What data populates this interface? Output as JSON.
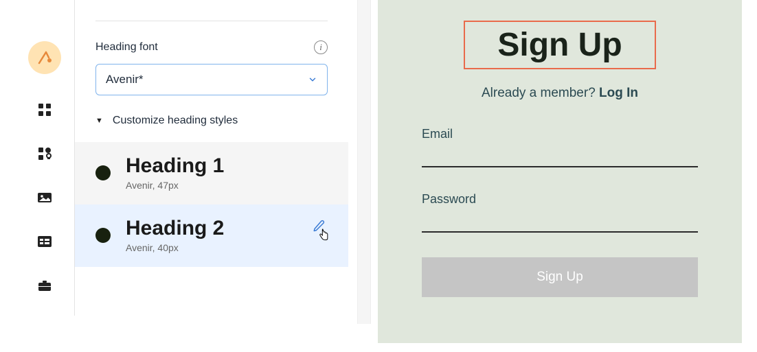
{
  "panel": {
    "heading_font_label": "Heading font",
    "font_select_value": "Avenir*",
    "customize_label": "Customize heading styles",
    "headings": [
      {
        "title": "Heading 1",
        "sub": "Avenir, 47px"
      },
      {
        "title": "Heading 2",
        "sub": "Avenir, 40px"
      }
    ]
  },
  "preview": {
    "title": "Sign Up",
    "member_text": "Already a member? ",
    "login_text": "Log In",
    "email_label": "Email",
    "password_label": "Password",
    "button_label": "Sign Up"
  }
}
